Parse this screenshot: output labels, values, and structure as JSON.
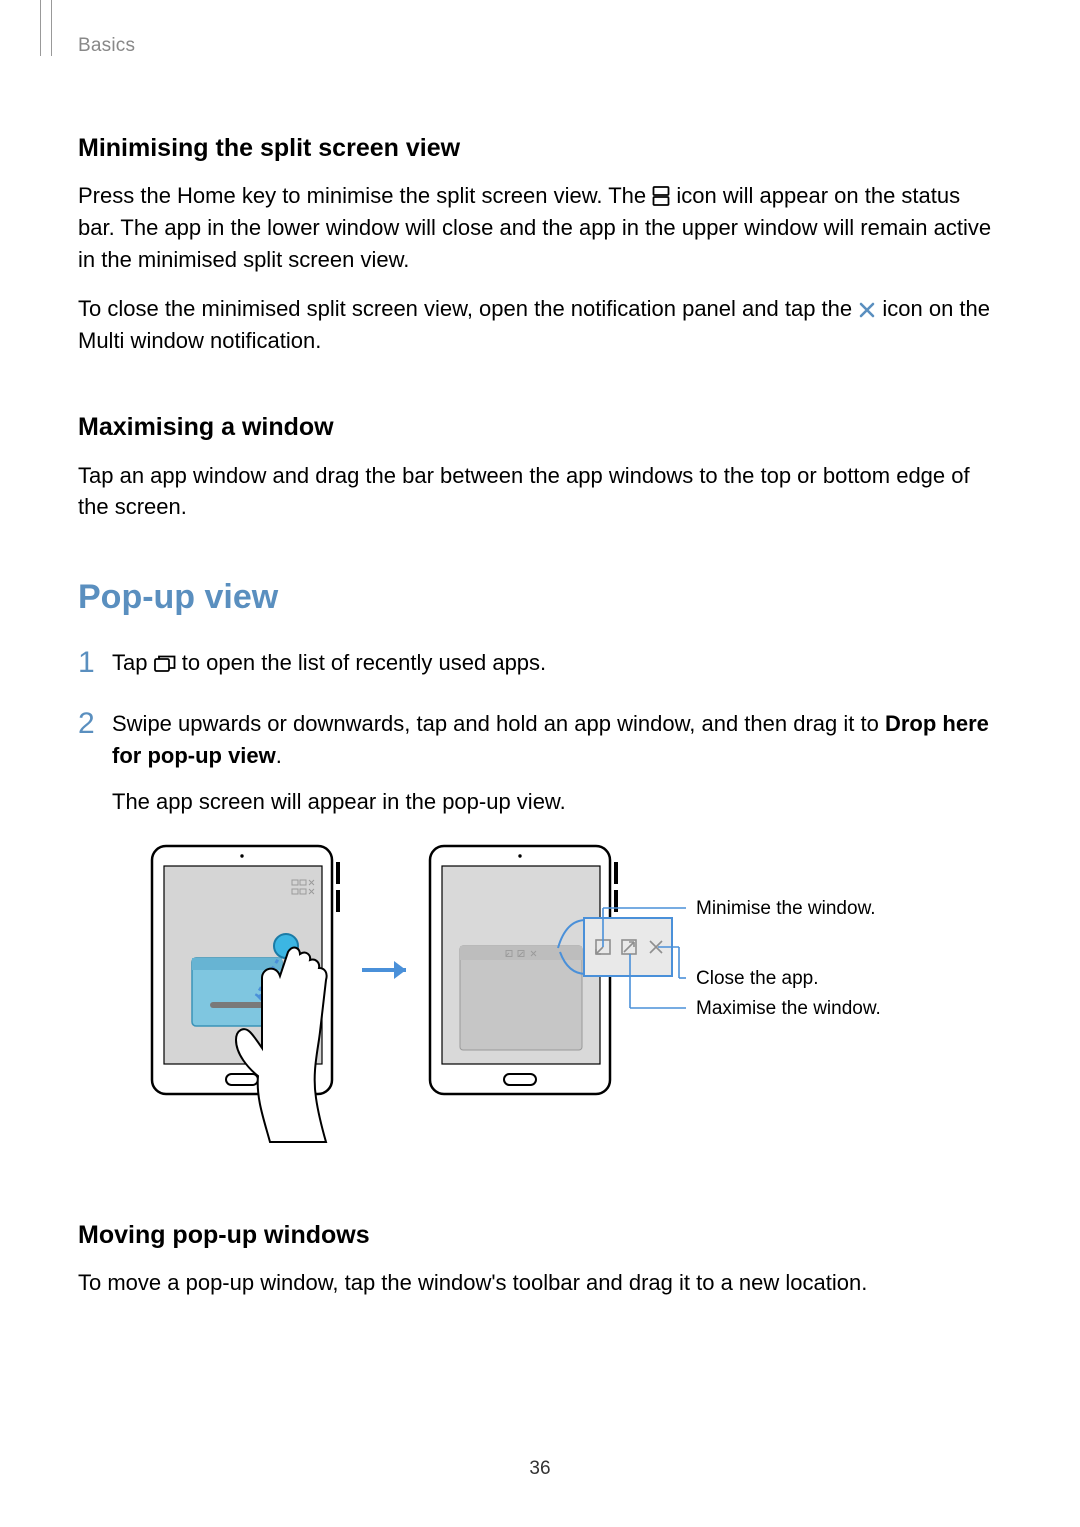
{
  "header": {
    "section_label": "Basics"
  },
  "sec1": {
    "heading": "Minimising the split screen view",
    "p1a": "Press the Home key to minimise the split screen view. The ",
    "p1b": " icon will appear on the status bar. The app in the lower window will close and the app in the upper window will remain active in the minimised split screen view.",
    "p2a": "To close the minimised split screen view, open the notification panel and tap the ",
    "p2b": " icon on the Multi window notification."
  },
  "sec2": {
    "heading": "Maximising a window",
    "p1": "Tap an app window and drag the bar between the app windows to the top or bottom edge of the screen."
  },
  "popup": {
    "heading": "Pop-up view",
    "step1a": "Tap ",
    "step1b": " to open the list of recently used apps.",
    "step2a": "Swipe upwards or downwards, tap and hold an app window, and then drag it to ",
    "step2b": "Drop here for pop-up view",
    "step2c": ".",
    "step2_sub": "The app screen will appear in the pop-up view.",
    "callouts": {
      "minimise": "Minimise the window.",
      "close": "Close the app.",
      "maximise": "Maximise the window."
    }
  },
  "sec3": {
    "heading": "Moving pop-up windows",
    "p1": "To move a pop-up window, tap the window's toolbar and drag it to a new location."
  },
  "page_number": "36",
  "colors": {
    "heading_blue": "#5a8fbf",
    "callout_blue": "#4a90d9",
    "touch_fill": "#3cb6e3"
  }
}
